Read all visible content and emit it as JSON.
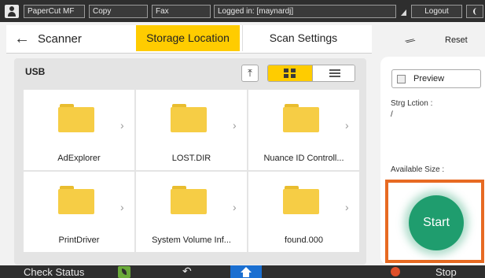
{
  "topbar": {
    "app": "PaperCut MF",
    "copy": "Copy",
    "fax": "Fax",
    "logged_in": "Logged in: [maynardj]",
    "logout": "Logout"
  },
  "header": {
    "back_icon": "back-arrow",
    "title": "Scanner",
    "tabs": [
      {
        "label": "Storage Location",
        "active": true
      },
      {
        "label": "Scan Settings",
        "active": false
      }
    ],
    "pin_icon": "pin",
    "reset": "Reset"
  },
  "browser": {
    "location": "USB",
    "up_icon": "up-to-top",
    "view_modes": [
      "grid",
      "list"
    ],
    "active_view": "grid",
    "items": [
      {
        "name": "AdExplorer"
      },
      {
        "name": "LOST.DIR"
      },
      {
        "name": "Nuance ID Controll..."
      },
      {
        "name": "PrintDriver"
      },
      {
        "name": "System Volume Inf..."
      },
      {
        "name": "found.000"
      }
    ]
  },
  "side": {
    "preview": "Preview",
    "storage_label": "Strg Lction :",
    "storage_value": "/",
    "available_label": "Available Size :",
    "start": "Start",
    "accent": "#e76a22",
    "start_color": "#1f9d6e"
  },
  "bottombar": {
    "check_status": "Check Status",
    "stop": "Stop",
    "home_color": "#1a6fd1"
  }
}
